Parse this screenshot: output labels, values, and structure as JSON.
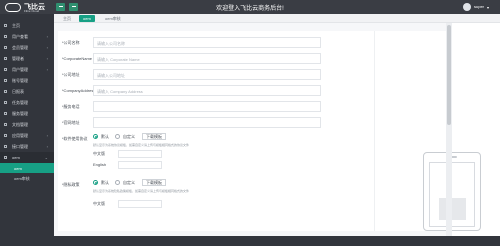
{
  "header": {
    "logo_text": "飞比云",
    "logo_subtext": "Fibie Cloud",
    "welcome": "欢迎登入飞比云商务后台!",
    "user_name": "super"
  },
  "sidebar": {
    "items": [
      {
        "label": "主页",
        "icon": "home-icon"
      },
      {
        "label": "用户查看",
        "icon": "user-icon"
      },
      {
        "label": "会员管理",
        "icon": "member-icon"
      },
      {
        "label": "管理者",
        "icon": "admin-icon"
      },
      {
        "label": "用户管理",
        "icon": "users-icon"
      },
      {
        "label": "账号管理",
        "icon": "account-icon"
      },
      {
        "label": "日报表",
        "icon": "report-icon"
      },
      {
        "label": "任务管理",
        "icon": "task-icon"
      },
      {
        "label": "服务管理",
        "icon": "service-icon"
      },
      {
        "label": "文档管理",
        "icon": "doc-icon"
      },
      {
        "label": "应用管理",
        "icon": "app-icon"
      },
      {
        "label": "接口管理",
        "icon": "api-icon"
      },
      {
        "label": "oem",
        "icon": "oem-icon"
      }
    ],
    "submenu": [
      {
        "label": "oem"
      },
      {
        "label": "oem审核"
      }
    ]
  },
  "tabs": [
    {
      "label": "主页"
    },
    {
      "label": "oem"
    },
    {
      "label": "oem审核"
    }
  ],
  "form": {
    "company_name": {
      "label": "*公司名称",
      "placeholder": "请输入公司名称"
    },
    "company_name_en": {
      "label": "*CorporateName",
      "placeholder": "请输入 Corporate Name"
    },
    "company_addr": {
      "label": "*公司地址",
      "placeholder": "请输入公司地址"
    },
    "company_addr_en": {
      "label": "*CompanyAddress",
      "placeholder": "请输入 Company Address"
    },
    "service_phone": {
      "label": "*服务电话"
    },
    "website": {
      "label": "*官网地址"
    },
    "service_agreement": {
      "label": "*软件使用协议",
      "option_default": "默认",
      "option_custom": "自定义",
      "download_button": "下载模板",
      "note": "默认显示为系统协议模板，如需自定义请上传与模板相同格式的协议文件",
      "zh_label": "中文版",
      "en_label": "English"
    },
    "privacy_policy": {
      "label": "*隐私政策",
      "option_default": "默认",
      "option_custom": "自定义",
      "download_button": "下载模板",
      "note": "默认显示为系统隐私政策模板，如需自定义请上传与模板相同格式的文件",
      "zh_label": "中文版"
    }
  },
  "colors": {
    "accent": "#17a085",
    "header_bg": "#3a3d44",
    "sidebar_bg": "#32353c"
  }
}
